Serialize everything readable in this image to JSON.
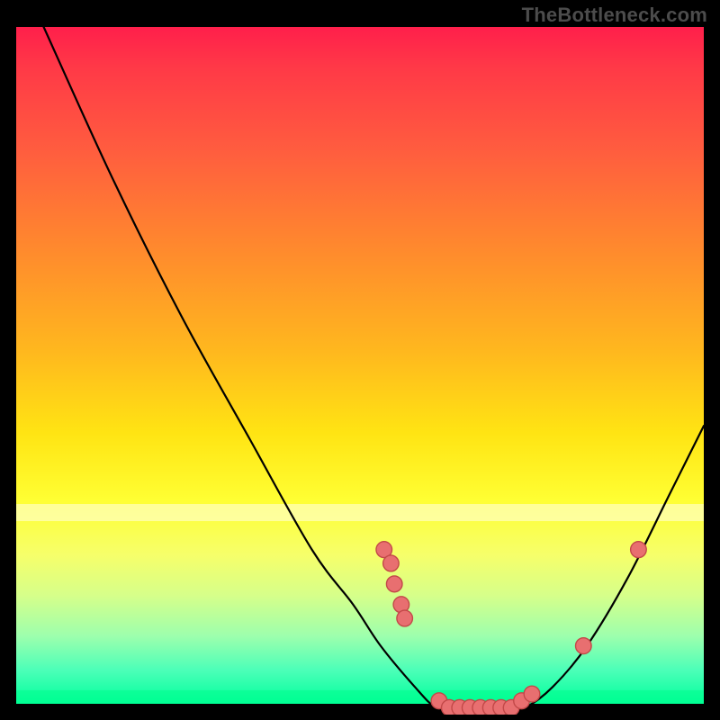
{
  "watermark": "TheBottleneck.com",
  "chart_data": {
    "type": "line",
    "title": "",
    "xlabel": "",
    "ylabel": "",
    "xlim": [
      0,
      100
    ],
    "ylim": [
      0,
      100
    ],
    "grid": false,
    "legend": false,
    "curve": [
      {
        "x": 4,
        "y": 100
      },
      {
        "x": 14,
        "y": 78
      },
      {
        "x": 24,
        "y": 58
      },
      {
        "x": 34,
        "y": 40
      },
      {
        "x": 43,
        "y": 24
      },
      {
        "x": 49,
        "y": 16
      },
      {
        "x": 53,
        "y": 10
      },
      {
        "x": 58,
        "y": 4
      },
      {
        "x": 61,
        "y": 1
      },
      {
        "x": 64,
        "y": 0
      },
      {
        "x": 70,
        "y": 0
      },
      {
        "x": 74,
        "y": 1
      },
      {
        "x": 78,
        "y": 4
      },
      {
        "x": 83,
        "y": 10
      },
      {
        "x": 89,
        "y": 20
      },
      {
        "x": 95,
        "y": 32
      },
      {
        "x": 100,
        "y": 42
      }
    ],
    "series": [
      {
        "name": "markers-left-cluster",
        "points": [
          {
            "x": 53.5,
            "y": 24
          },
          {
            "x": 54.5,
            "y": 22
          },
          {
            "x": 55.0,
            "y": 19
          },
          {
            "x": 56.0,
            "y": 16
          },
          {
            "x": 56.5,
            "y": 14
          }
        ]
      },
      {
        "name": "markers-bottom-row",
        "points": [
          {
            "x": 61.5,
            "y": 2
          },
          {
            "x": 63.0,
            "y": 1
          },
          {
            "x": 64.5,
            "y": 1
          },
          {
            "x": 66.0,
            "y": 1
          },
          {
            "x": 67.5,
            "y": 1
          },
          {
            "x": 69.0,
            "y": 1
          },
          {
            "x": 70.5,
            "y": 1
          },
          {
            "x": 72.0,
            "y": 1
          },
          {
            "x": 73.5,
            "y": 2
          },
          {
            "x": 75.0,
            "y": 3
          }
        ]
      },
      {
        "name": "markers-right-pair",
        "points": [
          {
            "x": 82.5,
            "y": 10
          },
          {
            "x": 90.5,
            "y": 24
          }
        ]
      }
    ],
    "bands": [
      {
        "y0": 27,
        "y1": 29.5,
        "kind": "white"
      },
      {
        "y0": 0,
        "y1": 2,
        "kind": "green-edge"
      }
    ],
    "colors": {
      "curve": "#000000",
      "markers_fill": "#e86f70",
      "markers_stroke": "#c24848"
    }
  }
}
